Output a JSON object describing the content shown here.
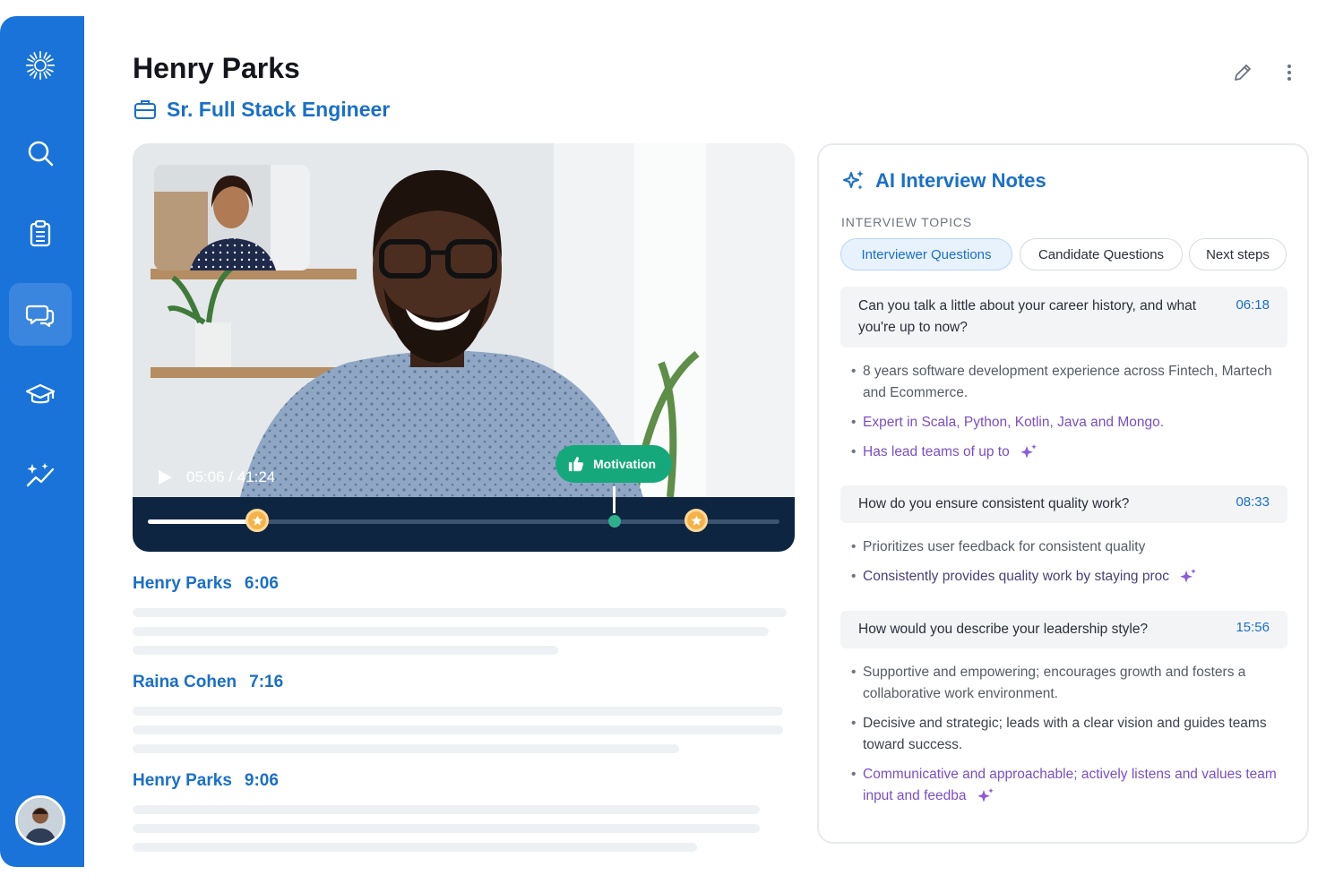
{
  "candidate": {
    "name": "Henry Parks",
    "role": "Sr. Full Stack Engineer"
  },
  "video": {
    "time": "05:06 / 41:24",
    "progress": 0.18,
    "highlight_tag": "Motivation"
  },
  "transcript": [
    {
      "speaker": "Henry Parks",
      "time": "6:06"
    },
    {
      "speaker": "Raina Cohen",
      "time": "7:16"
    },
    {
      "speaker": "Henry Parks",
      "time": "9:06"
    }
  ],
  "notes": {
    "title": "AI Interview Notes",
    "topics_label": "INTERVIEW TOPICS",
    "chips": [
      {
        "label": "Interviewer Questions",
        "active": true
      },
      {
        "label": "Candidate Questions",
        "active": false
      },
      {
        "label": "Next steps",
        "active": false
      }
    ],
    "questions": [
      {
        "text": "Can you talk a little about your career history, and what you're up to now?",
        "time": "06:18",
        "bullets": [
          "8 years software development experience across Fintech, Martech and Ecommerce.",
          "Expert in Scala, Python, Kotlin, Java and Mongo.",
          "Has lead teams of up to"
        ]
      },
      {
        "text": "How do you ensure consistent quality work?",
        "time": "08:33",
        "bullets": [
          "Prioritizes user feedback for consistent quality",
          "Consistently provides quality work by staying proc"
        ]
      },
      {
        "text": "How would you describe your leadership style?",
        "time": "15:56",
        "bullets": [
          "Supportive and empowering; encourages growth and fosters a collaborative work environment.",
          "Decisive and strategic; leads with a clear vision and guides teams toward success.",
          "Communicative and approachable; actively listens and values team input and feedba"
        ]
      }
    ]
  },
  "colors": {
    "sidebar": "#1a73d9",
    "accent": "#1a6fc9",
    "motivation": "#15a87b",
    "ai_purple": "#7a4fc4"
  },
  "icons": [
    "logo-icon",
    "search-icon",
    "clipboard-icon",
    "chat-icon",
    "graduation-cap-icon",
    "sparkle-chart-icon",
    "pencil-icon",
    "more-vertical-icon",
    "briefcase-icon",
    "sparkles-icon",
    "play-icon",
    "thumbs-up-icon",
    "star-icon"
  ]
}
